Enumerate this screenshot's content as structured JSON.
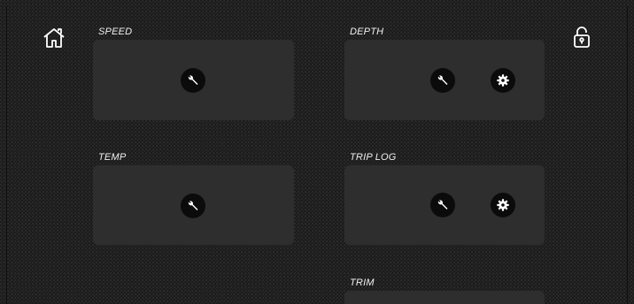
{
  "header": {
    "home_icon": "home-icon",
    "lock_icon": "unlock-icon"
  },
  "widgets": [
    {
      "label": "SPEED"
    },
    {
      "label": "DEPTH"
    },
    {
      "label": "TEMP"
    },
    {
      "label": "TRIP LOG"
    },
    {
      "label": "TRIM"
    }
  ],
  "colors": {
    "card": "#2e2e2e",
    "button": "#0b0b0b",
    "icon": "#ffffff"
  }
}
